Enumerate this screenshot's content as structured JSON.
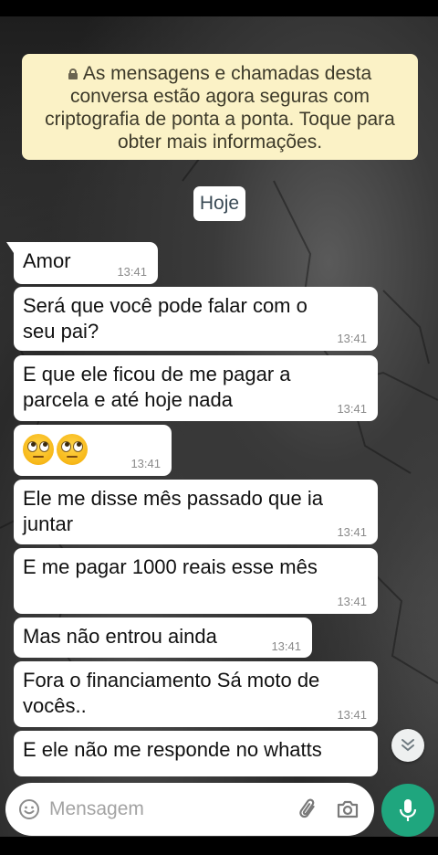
{
  "encryption_notice": {
    "text": "As mensagens e chamadas desta conversa estão agora seguras com criptografia de ponta a ponta. Toque para obter mais informações."
  },
  "date_chip": "Hoje",
  "messages": [
    {
      "text": "Amor",
      "time": "13:41"
    },
    {
      "text": "Será que você pode falar com o seu pai?",
      "time": "13:41"
    },
    {
      "text": "E que ele ficou de me pagar a parcela e até hoje nada",
      "time": "13:41"
    },
    {
      "text": "",
      "emoji": [
        "face-with-rolling-eyes",
        "face-with-rolling-eyes"
      ],
      "time": "13:41"
    },
    {
      "text": "Ele me disse mês passado que ia juntar",
      "time": "13:41"
    },
    {
      "text": "E me pagar 1000 reais esse mês",
      "time": "13:41"
    },
    {
      "text": "Mas não entrou ainda",
      "time": "13:41"
    },
    {
      "text": "Fora o financiamento Sá moto de vocês..",
      "time": "13:41"
    },
    {
      "text": "E ele não me responde no whatts",
      "time": ""
    }
  ],
  "composer": {
    "placeholder": "Mensagem",
    "icons": [
      "emoji-icon",
      "paperclip-icon",
      "camera-icon",
      "mic-icon"
    ]
  },
  "icons": {
    "lock": "lock-icon",
    "scroll": "chevron-double-down-icon"
  },
  "colors": {
    "notice_bg": "#fbf2c6",
    "bubble_bg": "#ffffff",
    "mic_button": "#1fa67e",
    "timestamp": "#8a8a8a"
  }
}
